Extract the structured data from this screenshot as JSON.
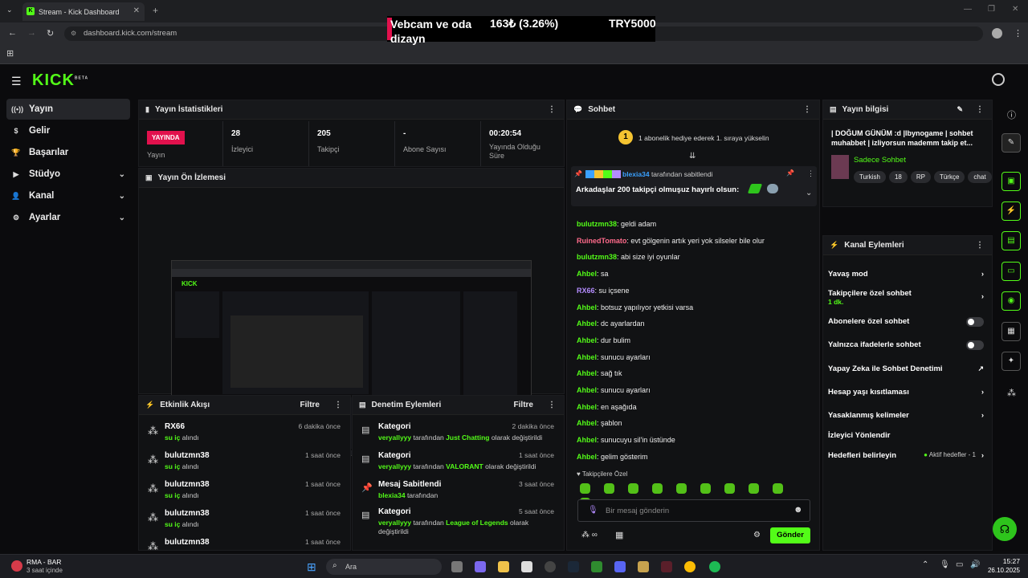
{
  "browser": {
    "tab_title": "Stream - Kick Dashboard",
    "url": "dashboard.kick.com/stream",
    "overlay_line1": "Vebcam ve oda",
    "overlay_line2": "dizayn",
    "overlay_price": "163₺ (3.26%)",
    "overlay_try": "TRY5000"
  },
  "app": {
    "logo": "KICK",
    "logo_beta": "BETA",
    "sidebar": [
      {
        "label": "Yayın",
        "icon": "broadcast-icon",
        "glyph": "((•))",
        "expand": ""
      },
      {
        "label": "Gelir",
        "icon": "dollar-icon",
        "glyph": "$",
        "expand": ""
      },
      {
        "label": "Başarılar",
        "icon": "trophy-icon",
        "glyph": "🏆",
        "expand": ""
      },
      {
        "label": "Stüdyo",
        "icon": "video-icon",
        "glyph": "▶",
        "expand": "⌄"
      },
      {
        "label": "Kanal",
        "icon": "user-icon",
        "glyph": "👤",
        "expand": "⌄"
      },
      {
        "label": "Ayarlar",
        "icon": "gear-icon",
        "glyph": "⚙",
        "expand": "⌄"
      }
    ]
  },
  "stats": {
    "title": "Yayın İstatistikleri",
    "live_badge": "YAYINDA",
    "live_label": "Yayın",
    "viewers_value": "28",
    "viewers_label": "İzleyici",
    "followers_value": "205",
    "followers_label": "Takipçi",
    "subs_value": "-",
    "subs_label": "Abone Sayısı",
    "uptime_value": "00:20:54",
    "uptime_label": "Yayında Olduğu Süre"
  },
  "preview": {
    "title": "Yayın Ön İzlemesi"
  },
  "activity": {
    "title": "Etkinlik Akışı",
    "filter": "Filtre",
    "items": [
      {
        "name": "RX66",
        "action": "su iç",
        "suffix": "alındı",
        "time": "6 dakika önce"
      },
      {
        "name": "bulutzmn38",
        "action": "su iç",
        "suffix": "alındı",
        "time": "1 saat önce"
      },
      {
        "name": "bulutzmn38",
        "action": "su iç",
        "suffix": "alındı",
        "time": "1 saat önce"
      },
      {
        "name": "bulutzmn38",
        "action": "su iç",
        "suffix": "alındı",
        "time": "1 saat önce"
      },
      {
        "name": "bulutzmn38",
        "action": "",
        "suffix": "",
        "time": "1 saat önce"
      }
    ]
  },
  "moderation": {
    "title": "Denetim Eylemleri",
    "filter": "Filtre",
    "items": [
      {
        "title": "Kategori",
        "user": "veryallyyy",
        "mid": "tarafından",
        "value": "Just Chatting",
        "tail": "olarak değiştirildi",
        "time": "2 dakika önce"
      },
      {
        "title": "Kategori",
        "user": "veryallyyy",
        "mid": "tarafından",
        "value": "VALORANT",
        "tail": "olarak değiştirildi",
        "time": "1 saat önce"
      },
      {
        "title": "Mesaj Sabitlendi",
        "user": "blexia34",
        "mid": "tarafından",
        "value": "",
        "tail": "",
        "time": "3 saat önce"
      },
      {
        "title": "Kategori",
        "user": "veryallyyy",
        "mid": "tarafından",
        "value": "League of Legends",
        "tail": "olarak değiştirildi",
        "time": "5 saat önce"
      }
    ]
  },
  "chat": {
    "title": "Sohbet",
    "gift_rank": "1",
    "gift_text": "1 abonelik hediye ederek 1. sıraya yükselin",
    "pinned_by": "blexia34",
    "pinned_by_suffix": "tarafından sabitlendi",
    "pinned_message": "Arkadaşlar 200 takipçi olmuşuz hayırlı olsun:",
    "messages": [
      {
        "user": "bulutzmn38",
        "text": "geldi adam",
        "color": "#53fc18"
      },
      {
        "user": "RuinedTomato",
        "text": "evt gölgenin artık yeri yok silseler bile olur",
        "color": "#ff6b8b"
      },
      {
        "user": "bulutzmn38",
        "text": "abi size iyi oyunlar",
        "color": "#53fc18"
      },
      {
        "user": "Ahbel",
        "text": "sa",
        "color": "#53fc18"
      },
      {
        "user": "RX66",
        "text": "su içsene",
        "color": "#b48cff"
      },
      {
        "user": "Ahbel",
        "text": "botsuz yapılıyor yetkisi varsa",
        "color": "#53fc18"
      },
      {
        "user": "Ahbel",
        "text": "dc ayarlardan",
        "color": "#53fc18"
      },
      {
        "user": "Ahbel",
        "text": "dur bulim",
        "color": "#53fc18"
      },
      {
        "user": "Ahbel",
        "text": "sunucu ayarları",
        "color": "#53fc18"
      },
      {
        "user": "Ahbel",
        "text": "sağ tık",
        "color": "#53fc18"
      },
      {
        "user": "Ahbel",
        "text": "sunucu ayarları",
        "color": "#53fc18"
      },
      {
        "user": "Ahbel",
        "text": "en aşağıda",
        "color": "#53fc18"
      },
      {
        "user": "Ahbel",
        "text": "şablon",
        "color": "#53fc18"
      },
      {
        "user": "Ahbel",
        "text": "sunucuyu sil'in üstünde",
        "color": "#53fc18"
      },
      {
        "user": "Ahbel",
        "text": "gelim gösterim",
        "color": "#53fc18"
      }
    ],
    "emote_section": "Takipçilere Özel",
    "input_placeholder": "Bir mesaj gönderin",
    "send": "Gönder",
    "infinity": "∞"
  },
  "info": {
    "title": "Yayın bilgisi",
    "stream_title": "| DOĞUM GÜNÜM :d |lbynogame | sohbet muhabbet | izliyorsun mademm takip et...",
    "chat_mode": "Sadece Sohbet",
    "tags": [
      "Turkish",
      "18",
      "RP",
      "Türkçe",
      "chat"
    ]
  },
  "channel": {
    "title": "Kanal Eylemleri",
    "slow_mode": "Yavaş mod",
    "followers_only": "Takipçilere özel sohbet",
    "followers_only_sub": "1 dk.",
    "subs_only": "Abonelere özel sohbet",
    "emote_only": "Yalnızca ifadelerle sohbet",
    "ai_mod": "Yapay Zeka ile Sohbet Denetimi",
    "age_limit": "Hesap yaşı kısıtlaması",
    "banned_words": "Yasaklanmış kelimeler",
    "raid": "İzleyici Yönlendir",
    "goals": "Hedefleri belirleyin",
    "goals_status": "Aktif hedefler - 1"
  },
  "taskbar": {
    "weather_title": "RMA - BAR",
    "weather_sub": "3 saat içinde",
    "search": "Ara",
    "time": "15:27",
    "date": "26.10.2025"
  },
  "colors": {
    "accent": "#53fc18",
    "live": "#e2114d",
    "panel": "#111214"
  }
}
